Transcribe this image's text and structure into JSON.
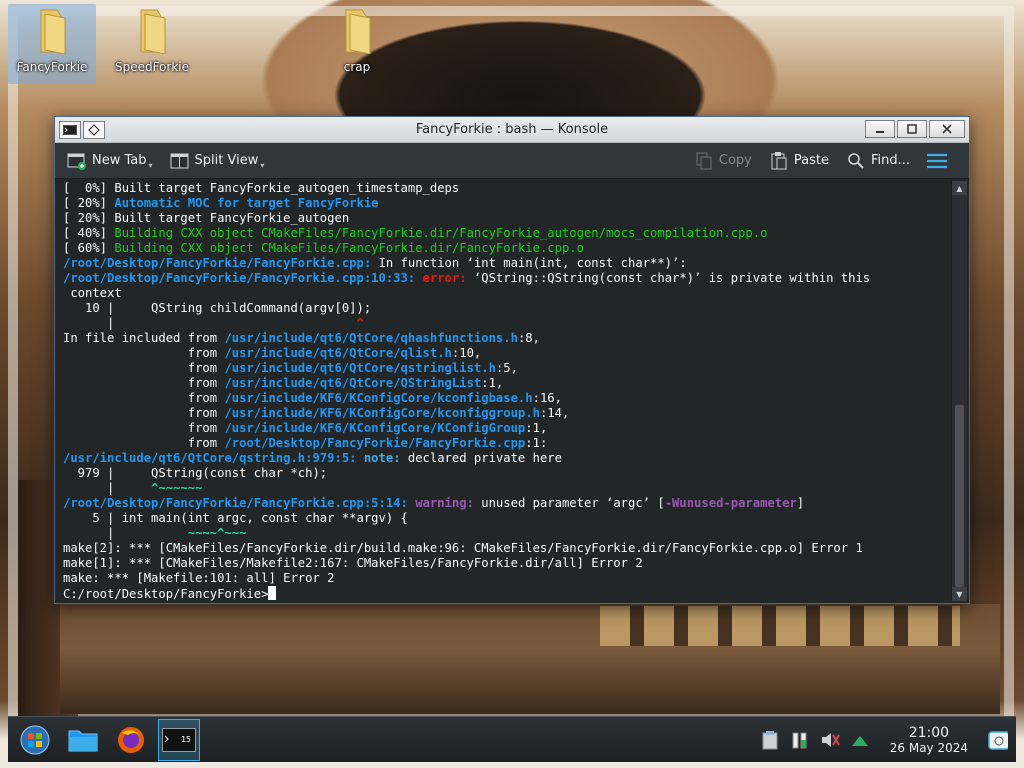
{
  "desktop": {
    "icons": [
      {
        "label": "FancyForkie"
      },
      {
        "label": "SpeedForkie"
      },
      {
        "label": "crap"
      }
    ]
  },
  "window": {
    "title": "FancyForkie : bash — Konsole",
    "toolbar": {
      "new_tab": "New Tab",
      "split_view": "Split View",
      "copy": "Copy",
      "paste": "Paste",
      "find": "Find..."
    }
  },
  "terminal": {
    "lines": [
      "[  0%] Built target FancyForkie_autogen_timestamp_deps",
      "[ 20%] Automatic MOC for target FancyForkie",
      "[ 20%] Built target FancyForkie_autogen",
      "[ 40%] Building CXX object CMakeFiles/FancyForkie.dir/FancyForkie_autogen/mocs_compilation.cpp.o",
      "[ 60%] Building CXX object CMakeFiles/FancyForkie.dir/FancyForkie.cpp.o",
      "/root/Desktop/FancyForkie/FancyForkie.cpp: In function ‘int main(int, const char**)’:",
      "/root/Desktop/FancyForkie/FancyForkie.cpp:10:33: error: ‘QString::QString(const char*)’ is private within this",
      " context",
      "   10 |     QString childCommand(argv[0]);",
      "      |                                 ^",
      "In file included from /usr/include/qt6/QtCore/qhashfunctions.h:8,",
      "                 from /usr/include/qt6/QtCore/qlist.h:10,",
      "                 from /usr/include/qt6/QtCore/qstringlist.h:5,",
      "                 from /usr/include/qt6/QtCore/QStringList:1,",
      "                 from /usr/include/KF6/KConfigCore/kconfigbase.h:16,",
      "                 from /usr/include/KF6/KConfigCore/kconfiggroup.h:14,",
      "                 from /usr/include/KF6/KConfigCore/KConfigGroup:1,",
      "                 from /root/Desktop/FancyForkie/FancyForkie.cpp:1:",
      "/usr/include/qt6/QtCore/qstring.h:979:5: note: declared private here",
      "  979 |     QString(const char *ch);",
      "      |     ^~~~~~~",
      "/root/Desktop/FancyForkie/FancyForkie.cpp:5:14: warning: unused parameter ‘argc’ [-Wunused-parameter]",
      "    5 | int main(int argc, const char **argv) {",
      "      |          ~~~~^~~~",
      "make[2]: *** [CMakeFiles/FancyForkie.dir/build.make:96: CMakeFiles/FancyForkie.dir/FancyForkie.cpp.o] Error 1",
      "make[1]: *** [CMakeFiles/Makefile2:167: CMakeFiles/FancyForkie.dir/all] Error 2",
      "make: *** [Makefile:101: all] Error 2",
      "C:/root/Desktop/FancyForkie>"
    ]
  },
  "taskbar": {
    "clock_time": "21:00",
    "clock_date": "26 May 2024",
    "konsole_thumb_label": "15"
  },
  "colors": {
    "accent": "#3daee9",
    "terminal_bg": "#232627",
    "error": "#ed1515",
    "path_blue": "#1d99f3",
    "build_green": "#11d116"
  }
}
